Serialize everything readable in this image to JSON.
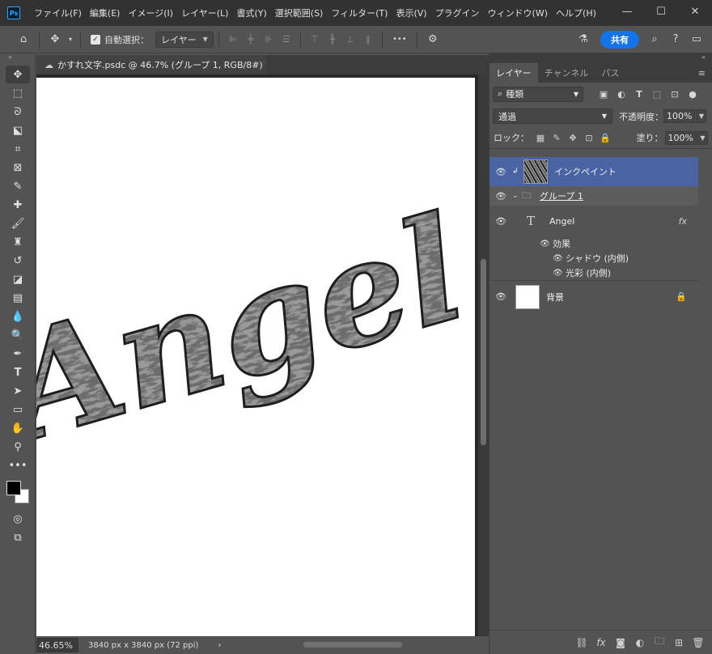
{
  "app": {
    "logo": "Ps",
    "menus": [
      "ファイル(F)",
      "編集(E)",
      "イメージ(I)",
      "レイヤー(L)",
      "書式(Y)",
      "選択範囲(S)",
      "フィルター(T)",
      "表示(V)",
      "プラグイン",
      "ウィンドウ(W)",
      "ヘルプ(H)"
    ]
  },
  "options": {
    "auto_select_label": "自動選択：",
    "auto_select_target": "レイヤー",
    "more": "•••",
    "share_label": "共有"
  },
  "document": {
    "tab_title": "かすれ文字.psdc @ 46.7% (グループ 1, RGB/8#) *",
    "canvas_text": "Angel",
    "zoom": "46.65%",
    "dimensions": "3840 px x 3840 px (72 ppi)",
    "status_arrow": "›"
  },
  "panel": {
    "tabs": [
      "レイヤー",
      "チャンネル",
      "パス"
    ],
    "kind_filter": "種類",
    "blend_mode": "通過",
    "opacity_label": "不透明度：",
    "opacity_value": "100%",
    "lock_label": "ロック：",
    "fill_label": "塗り：",
    "fill_value": "100%"
  },
  "layers": [
    {
      "name": "インクペイント",
      "type": "image",
      "selected": true
    },
    {
      "name": "グループ 1",
      "type": "group"
    },
    {
      "name": "Angel",
      "type": "text",
      "fx": "fx"
    },
    {
      "name": "背景",
      "type": "background"
    }
  ],
  "effects": {
    "header": "効果",
    "items": [
      "シャドウ (内側)",
      "光彩 (内側)"
    ]
  },
  "colors": {
    "accent": "#1473e6",
    "selected_layer": "#4a64a3",
    "foreground": "#000000",
    "background": "#ffffff"
  }
}
